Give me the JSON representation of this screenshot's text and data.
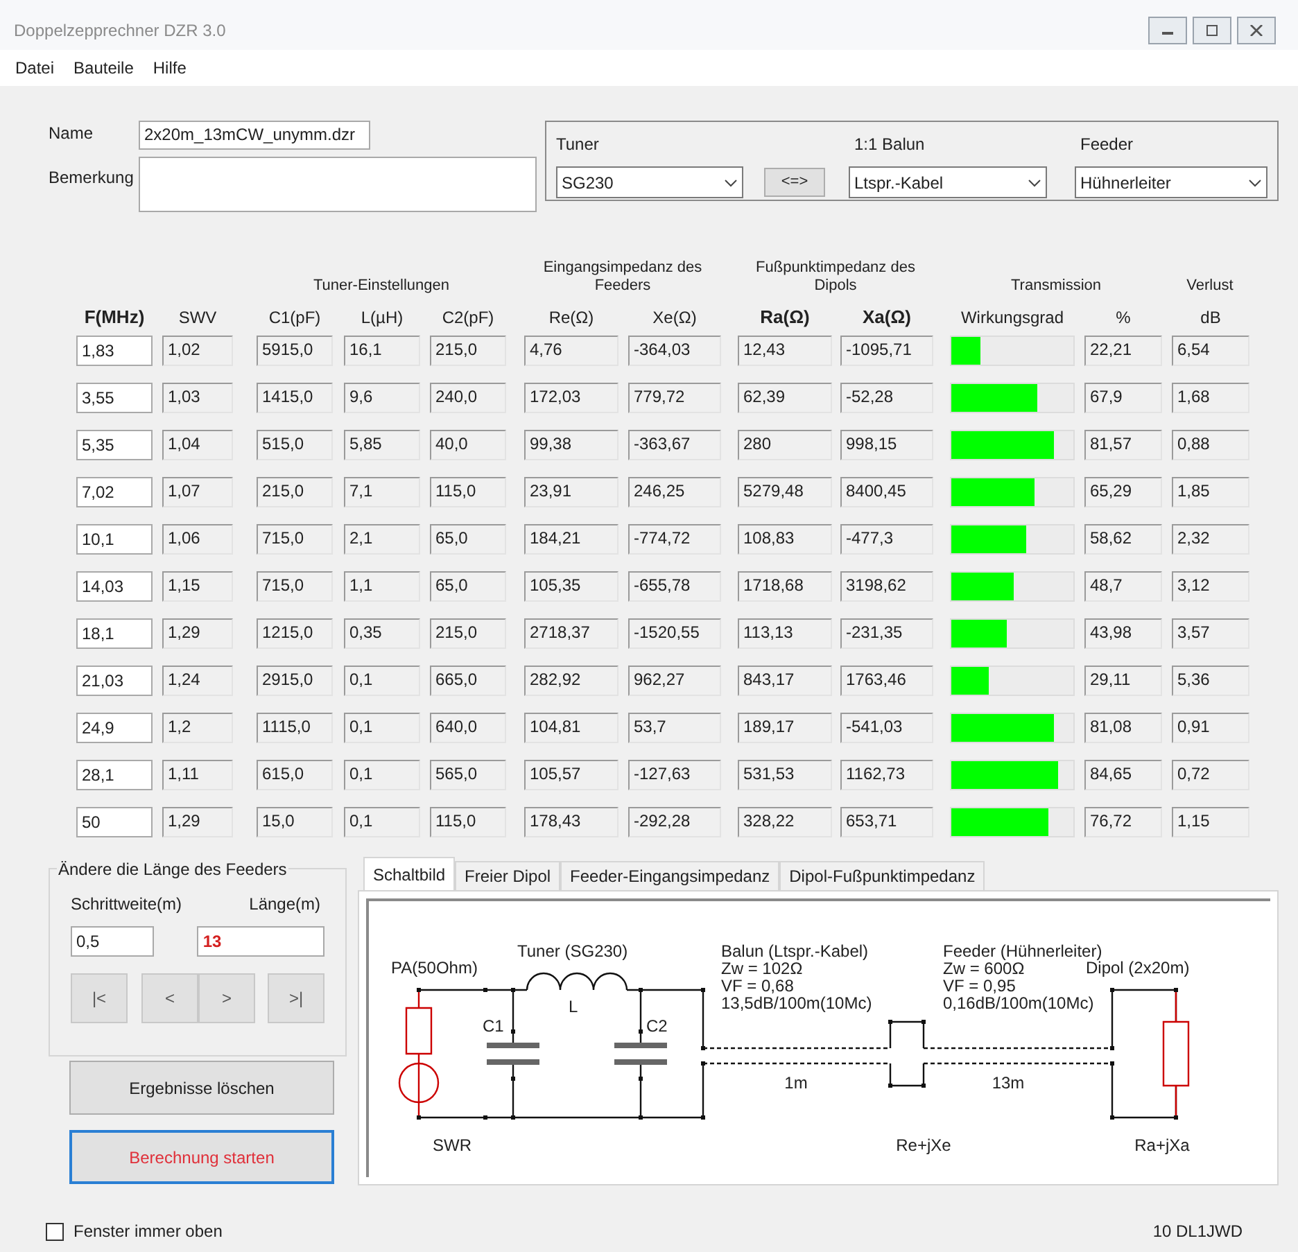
{
  "window": {
    "title": "Doppelzepprechner DZR 3.0"
  },
  "menu": [
    "Datei",
    "Bauteile",
    "Hilfe"
  ],
  "project": {
    "name_label": "Name",
    "name_value": "2x20m_13mCW_unymm.dzr",
    "remark_label": "Bemerkung"
  },
  "components": {
    "tuner": {
      "label": "Tuner",
      "value": "SG230"
    },
    "swap_button": "<=>",
    "balun": {
      "label": "1:1 Balun",
      "value": "Ltspr.-Kabel"
    },
    "feeder": {
      "label": "Feeder",
      "value": "Hühnerleiter"
    }
  },
  "table": {
    "group_headers": [
      "Tuner-Einstellungen",
      "Eingangsimpedanz des Feeders",
      "Fußpunktimpedanz des Dipols",
      "Transmission",
      "Verlust"
    ],
    "columns": [
      {
        "label": "F(MHz)",
        "kind": "input",
        "emphasized": true
      },
      {
        "label": "SWV",
        "kind": "output",
        "emphasized": false
      },
      {
        "label": "C1(pF)",
        "kind": "output",
        "emphasized": false
      },
      {
        "label": "L(µH)",
        "kind": "output",
        "emphasized": false
      },
      {
        "label": "C2(pF)",
        "kind": "output",
        "emphasized": false
      },
      {
        "label": "Re(Ω)",
        "kind": "output",
        "emphasized": false
      },
      {
        "label": "Xe(Ω)",
        "kind": "output",
        "emphasized": false
      },
      {
        "label": "Ra(Ω)",
        "kind": "output",
        "emphasized": true
      },
      {
        "label": "Xa(Ω)",
        "kind": "output",
        "emphasized": true
      },
      {
        "label": "Wirkungsgrad",
        "kind": "bar",
        "emphasized": false
      },
      {
        "label": "%",
        "kind": "output",
        "emphasized": false
      },
      {
        "label": "dB",
        "kind": "output",
        "emphasized": false
      }
    ],
    "rows": [
      {
        "values": [
          "1,83",
          "1,02",
          "5915,0",
          "16,1",
          "215,0",
          "4,76",
          "-364,03",
          "12,43",
          "-1095,71",
          "22,21",
          "6,54"
        ],
        "level": 0.24
      },
      {
        "values": [
          "3,55",
          "1,03",
          "1415,0",
          "9,6",
          "240,0",
          "172,03",
          "779,72",
          "62,39",
          "-52,28",
          "67,9",
          "1,68"
        ],
        "level": 0.7
      },
      {
        "values": [
          "5,35",
          "1,04",
          "515,0",
          "5,85",
          "40,0",
          "99,38",
          "-363,67",
          "280",
          "998,15",
          "81,57",
          "0,88"
        ],
        "level": 0.84
      },
      {
        "values": [
          "7,02",
          "1,07",
          "215,0",
          "7,1",
          "115,0",
          "23,91",
          "246,25",
          "5279,48",
          "8400,45",
          "65,29",
          "1,85"
        ],
        "level": 0.68
      },
      {
        "values": [
          "10,1",
          "1,06",
          "715,0",
          "2,1",
          "65,0",
          "184,21",
          "-774,72",
          "108,83",
          "-477,3",
          "58,62",
          "2,32"
        ],
        "level": 0.61
      },
      {
        "values": [
          "14,03",
          "1,15",
          "715,0",
          "1,1",
          "65,0",
          "105,35",
          "-655,78",
          "1718,68",
          "3198,62",
          "48,7",
          "3,12"
        ],
        "level": 0.51
      },
      {
        "values": [
          "18,1",
          "1,29",
          "1215,0",
          "0,35",
          "215,0",
          "2718,37",
          "-1520,55",
          "113,13",
          "-231,35",
          "43,98",
          "3,57"
        ],
        "level": 0.46
      },
      {
        "values": [
          "21,03",
          "1,24",
          "2915,0",
          "0,1",
          "665,0",
          "282,92",
          "962,27",
          "843,17",
          "1763,46",
          "29,11",
          "5,36"
        ],
        "level": 0.31
      },
      {
        "values": [
          "24,9",
          "1,2",
          "1115,0",
          "0,1",
          "640,0",
          "104,81",
          "53,7",
          "189,17",
          "-541,03",
          "81,08",
          "0,91"
        ],
        "level": 0.84
      },
      {
        "values": [
          "28,1",
          "1,11",
          "615,0",
          "0,1",
          "565,0",
          "105,57",
          "-127,63",
          "531,53",
          "1162,73",
          "84,65",
          "0,72"
        ],
        "level": 0.88
      },
      {
        "values": [
          "50",
          "1,29",
          "15,0",
          "0,1",
          "115,0",
          "178,43",
          "-292,28",
          "328,22",
          "653,71",
          "76,72",
          "1,15"
        ],
        "level": 0.79
      }
    ]
  },
  "feeder_length": {
    "title": "Ändere die Länge des Feeders",
    "step_label": "Schrittweite(m)",
    "length_label": "Länge(m)",
    "step_value": "0,5",
    "length_value": "13",
    "nav_buttons": [
      "|<",
      "<",
      ">",
      ">|"
    ]
  },
  "actions": [
    {
      "label": "Ergebnisse löschen",
      "focused": false
    },
    {
      "label": "Berechnung starten",
      "focused": true
    }
  ],
  "tabs": [
    {
      "label": "Schaltbild",
      "selected": true
    },
    {
      "label": "Freier Dipol",
      "selected": false
    },
    {
      "label": "Feeder-Eingangsimpedanz",
      "selected": false
    },
    {
      "label": "Dipol-Fußpunktimpedanz",
      "selected": false
    }
  ],
  "schematic": {
    "source": "PA(50Ohm)",
    "tuner": "Tuner (SG230)",
    "inductor": "L",
    "c1": "C1",
    "c2": "C2",
    "balun_lines": [
      "Balun (Ltspr.-Kabel)",
      "Zw = 102Ω",
      "VF = 0,68",
      "13,5dB/100m(10Mc)"
    ],
    "feeder_lines": [
      "Feeder (Hühnerleiter)",
      "Zw = 600Ω",
      "VF = 0,95",
      "0,16dB/100m(10Mc)"
    ],
    "dipole": "Dipol (2x20m)",
    "balun_length": "1m",
    "feeder_length": "13m",
    "swr": "SWR",
    "input_impedance": "Re+jXe",
    "feedpoint_impedance": "Ra+jXa"
  },
  "always_on_top": {
    "label": "Fenster immer oben",
    "checked": false
  },
  "status": "10 DL1JWD"
}
